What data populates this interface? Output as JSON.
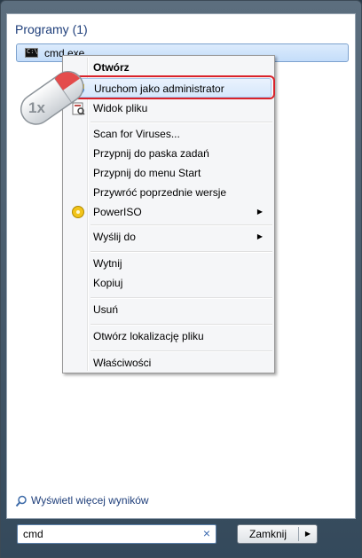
{
  "section_title": "Programy (1)",
  "result": {
    "label": "cmd.exe",
    "icon": "command-prompt-icon"
  },
  "badge": {
    "label": "1x",
    "icon": "mouse-icon"
  },
  "context_menu": {
    "open": "Otwórz",
    "run_as_admin": "Uruchom jako administrator",
    "file_view": "Widok pliku",
    "scan": "Scan for Viruses...",
    "pin_taskbar": "Przypnij do paska zadań",
    "pin_start": "Przypnij do menu Start",
    "restore_versions": "Przywróć poprzednie wersje",
    "poweriso": "PowerISO",
    "send_to": "Wyślij do",
    "cut": "Wytnij",
    "copy": "Kopiuj",
    "delete": "Usuń",
    "open_location": "Otwórz lokalizację pliku",
    "properties": "Właściwości",
    "submenu_arrow": "▶"
  },
  "more_results": "Wyświetl więcej wyników",
  "search": {
    "value": "cmd",
    "clear": "×"
  },
  "shutdown": {
    "label": "Zamknij",
    "arrow": "▶"
  },
  "colors": {
    "highlight_ring": "#d9222a",
    "link": "#1e3e7a",
    "selection": "#c4ddfa"
  }
}
